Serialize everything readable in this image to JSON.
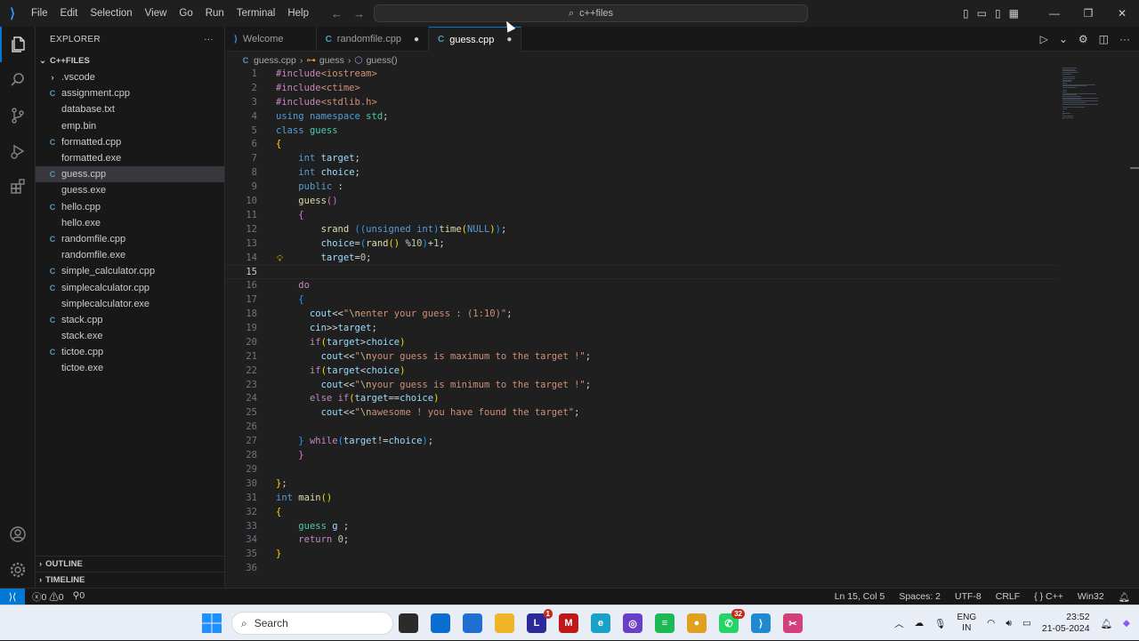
{
  "menu": [
    "File",
    "Edit",
    "Selection",
    "View",
    "Go",
    "Run",
    "Terminal",
    "Help"
  ],
  "search": {
    "text": "c++files"
  },
  "sidebar": {
    "title": "EXPLORER",
    "folder": "C++FILES",
    "files": [
      {
        "name": ".vscode",
        "type": "folder"
      },
      {
        "name": "assignment.cpp",
        "type": "cpp"
      },
      {
        "name": "database.txt",
        "type": "txt"
      },
      {
        "name": "emp.bin",
        "type": "bin"
      },
      {
        "name": "formatted.cpp",
        "type": "cpp"
      },
      {
        "name": "formatted.exe",
        "type": "exe"
      },
      {
        "name": "guess.cpp",
        "type": "cpp",
        "selected": true
      },
      {
        "name": "guess.exe",
        "type": "exe"
      },
      {
        "name": "hello.cpp",
        "type": "cpp"
      },
      {
        "name": "hello.exe",
        "type": "exe"
      },
      {
        "name": "randomfile.cpp",
        "type": "cpp"
      },
      {
        "name": "randomfile.exe",
        "type": "exe"
      },
      {
        "name": "simple_calculator.cpp",
        "type": "cpp"
      },
      {
        "name": "simplecalculator.cpp",
        "type": "cpp"
      },
      {
        "name": "simplecalculator.exe",
        "type": "exe"
      },
      {
        "name": "stack.cpp",
        "type": "cpp"
      },
      {
        "name": "stack.exe",
        "type": "exe"
      },
      {
        "name": "tictoe.cpp",
        "type": "cpp"
      },
      {
        "name": "tictoe.exe",
        "type": "exe"
      }
    ],
    "outline": "OUTLINE",
    "timeline": "TIMELINE"
  },
  "tabs": [
    {
      "label": "Welcome",
      "icon": "vscode-icon"
    },
    {
      "label": "randomfile.cpp",
      "icon": "cpp-icon",
      "modified": true
    },
    {
      "label": "guess.cpp",
      "icon": "cpp-icon",
      "modified": true,
      "active": true
    }
  ],
  "breadcrumb": [
    "guess.cpp",
    "guess",
    "guess()"
  ],
  "code": [
    [
      [
        "pp",
        "#include"
      ],
      [
        "str",
        "<iostream>"
      ]
    ],
    [
      [
        "pp",
        "#include"
      ],
      [
        "str",
        "<ctime>"
      ]
    ],
    [
      [
        "pp",
        "#include"
      ],
      [
        "str",
        "<stdlib.h>"
      ]
    ],
    [
      [
        "kw",
        "using"
      ],
      [
        "txt",
        " "
      ],
      [
        "kw",
        "namespace"
      ],
      [
        "txt",
        " "
      ],
      [
        "ty",
        "std"
      ],
      [
        "txt",
        ";"
      ]
    ],
    [
      [
        "kw",
        "class"
      ],
      [
        "txt",
        " "
      ],
      [
        "ty",
        "guess"
      ]
    ],
    [
      [
        "br1",
        "{"
      ]
    ],
    [
      [
        "txt",
        "    "
      ],
      [
        "kw",
        "int"
      ],
      [
        "txt",
        " "
      ],
      [
        "var",
        "target"
      ],
      [
        "txt",
        ";"
      ]
    ],
    [
      [
        "txt",
        "    "
      ],
      [
        "kw",
        "int"
      ],
      [
        "txt",
        " "
      ],
      [
        "var",
        "choice"
      ],
      [
        "txt",
        ";"
      ]
    ],
    [
      [
        "txt",
        "    "
      ],
      [
        "kw",
        "public"
      ],
      [
        "txt",
        " :"
      ]
    ],
    [
      [
        "txt",
        "    "
      ],
      [
        "fn",
        "guess"
      ],
      [
        "br2",
        "()"
      ]
    ],
    [
      [
        "txt",
        "    "
      ],
      [
        "br2",
        "{"
      ]
    ],
    [
      [
        "txt",
        "        "
      ],
      [
        "fn",
        "srand"
      ],
      [
        "txt",
        " "
      ],
      [
        "br3",
        "(("
      ],
      [
        "kw",
        "unsigned"
      ],
      [
        "txt",
        " "
      ],
      [
        "kw",
        "int"
      ],
      [
        "br3",
        ")"
      ],
      [
        "fn",
        "time"
      ],
      [
        "br1",
        "("
      ],
      [
        "kw",
        "NULL"
      ],
      [
        "br1",
        ")"
      ],
      [
        "br3",
        ")"
      ],
      [
        "txt",
        ";"
      ]
    ],
    [
      [
        "txt",
        "        "
      ],
      [
        "var",
        "choice"
      ],
      [
        "txt",
        "="
      ],
      [
        "br3",
        "("
      ],
      [
        "fn",
        "rand"
      ],
      [
        "br1",
        "()"
      ],
      [
        "txt",
        " %"
      ],
      [
        "num",
        "10"
      ],
      [
        "br3",
        ")"
      ],
      [
        "txt",
        "+"
      ],
      [
        "num",
        "1"
      ],
      [
        "txt",
        ";"
      ]
    ],
    [
      [
        "txt",
        "        "
      ],
      [
        "var",
        "target"
      ],
      [
        "txt",
        "="
      ],
      [
        "num",
        "0"
      ],
      [
        "txt",
        ";"
      ]
    ],
    [],
    [
      [
        "txt",
        "    "
      ],
      [
        "pp",
        "do"
      ]
    ],
    [
      [
        "txt",
        "    "
      ],
      [
        "br3",
        "{"
      ]
    ],
    [
      [
        "txt",
        "      "
      ],
      [
        "var",
        "cout"
      ],
      [
        "txt",
        "<<"
      ],
      [
        "str",
        "\""
      ],
      [
        "esc",
        "\\n"
      ],
      [
        "str",
        "enter your guess : (1:10)\""
      ],
      [
        "txt",
        ";"
      ]
    ],
    [
      [
        "txt",
        "      "
      ],
      [
        "var",
        "cin"
      ],
      [
        "txt",
        ">>"
      ],
      [
        "var",
        "target"
      ],
      [
        "txt",
        ";"
      ]
    ],
    [
      [
        "txt",
        "      "
      ],
      [
        "pp",
        "if"
      ],
      [
        "br1",
        "("
      ],
      [
        "var",
        "target"
      ],
      [
        "txt",
        ">"
      ],
      [
        "var",
        "choice"
      ],
      [
        "br1",
        ")"
      ]
    ],
    [
      [
        "txt",
        "        "
      ],
      [
        "var",
        "cout"
      ],
      [
        "txt",
        "<<"
      ],
      [
        "str",
        "\""
      ],
      [
        "esc",
        "\\n"
      ],
      [
        "str",
        "your guess is maximum to the target !\""
      ],
      [
        "txt",
        ";"
      ]
    ],
    [
      [
        "txt",
        "      "
      ],
      [
        "pp",
        "if"
      ],
      [
        "br1",
        "("
      ],
      [
        "var",
        "target"
      ],
      [
        "txt",
        "<"
      ],
      [
        "var",
        "choice"
      ],
      [
        "br1",
        ")"
      ]
    ],
    [
      [
        "txt",
        "        "
      ],
      [
        "var",
        "cout"
      ],
      [
        "txt",
        "<<"
      ],
      [
        "str",
        "\""
      ],
      [
        "esc",
        "\\n"
      ],
      [
        "str",
        "your guess is minimum to the target !\""
      ],
      [
        "txt",
        ";"
      ]
    ],
    [
      [
        "txt",
        "      "
      ],
      [
        "pp",
        "else"
      ],
      [
        "txt",
        " "
      ],
      [
        "pp",
        "if"
      ],
      [
        "br1",
        "("
      ],
      [
        "var",
        "target"
      ],
      [
        "txt",
        "=="
      ],
      [
        "var",
        "choice"
      ],
      [
        "br1",
        ")"
      ]
    ],
    [
      [
        "txt",
        "        "
      ],
      [
        "var",
        "cout"
      ],
      [
        "txt",
        "<<"
      ],
      [
        "str",
        "\""
      ],
      [
        "esc",
        "\\n"
      ],
      [
        "str",
        "awesome ! you have found the target\""
      ],
      [
        "txt",
        ";"
      ]
    ],
    [],
    [
      [
        "txt",
        "    "
      ],
      [
        "br3",
        "}"
      ],
      [
        "txt",
        " "
      ],
      [
        "pp",
        "while"
      ],
      [
        "br3",
        "("
      ],
      [
        "var",
        "target"
      ],
      [
        "txt",
        "!="
      ],
      [
        "var",
        "choice"
      ],
      [
        "br3",
        ")"
      ],
      [
        "txt",
        ";"
      ]
    ],
    [
      [
        "txt",
        "    "
      ],
      [
        "br2",
        "}"
      ]
    ],
    [],
    [
      [
        "br1",
        "}"
      ],
      [
        "txt",
        ";"
      ]
    ],
    [
      [
        "kw",
        "int"
      ],
      [
        "txt",
        " "
      ],
      [
        "fn",
        "main"
      ],
      [
        "br1",
        "()"
      ]
    ],
    [
      [
        "br1",
        "{"
      ]
    ],
    [
      [
        "txt",
        "    "
      ],
      [
        "ty",
        "guess"
      ],
      [
        "txt",
        " "
      ],
      [
        "var",
        "g"
      ],
      [
        "txt",
        " ;"
      ]
    ],
    [
      [
        "txt",
        "    "
      ],
      [
        "pp",
        "return"
      ],
      [
        "txt",
        " "
      ],
      [
        "num",
        "0"
      ],
      [
        "txt",
        ";"
      ]
    ],
    [
      [
        "br1",
        "}"
      ]
    ],
    []
  ],
  "current_line": 15,
  "status": {
    "errors": "0",
    "warnings": "0",
    "ports": "0",
    "position": "Ln 15, Col 5",
    "spaces": "Spaces: 2",
    "encoding": "UTF-8",
    "eol": "CRLF",
    "language": "{ } C++",
    "platform": "Win32"
  },
  "taskbar": {
    "search_placeholder": "Search",
    "apps": [
      {
        "name": "file-explorer-dark",
        "color": "#2b2b2b",
        "glyph": ""
      },
      {
        "name": "azure-app",
        "color": "#0a6ed1",
        "glyph": ""
      },
      {
        "name": "store",
        "color": "#1f6fd1",
        "glyph": ""
      },
      {
        "name": "folder",
        "color": "#f0b429",
        "glyph": ""
      },
      {
        "name": "linkedin-app",
        "color": "#2a2a9a",
        "glyph": "L",
        "badge": "1"
      },
      {
        "name": "mcafee",
        "color": "#c01818",
        "glyph": "M"
      },
      {
        "name": "edge",
        "color": "#1aa0c9",
        "glyph": "e"
      },
      {
        "name": "media-app",
        "color": "#6a3fc7",
        "glyph": "◎"
      },
      {
        "name": "spotify",
        "color": "#1db954",
        "glyph": "≡"
      },
      {
        "name": "chrome",
        "color": "#e0a020",
        "glyph": "●"
      },
      {
        "name": "whatsapp",
        "color": "#25d366",
        "glyph": "✆",
        "badge": "32"
      },
      {
        "name": "vscode",
        "color": "#1f8ad2",
        "glyph": "⟩"
      },
      {
        "name": "snipping-tool",
        "color": "#d23f7a",
        "glyph": "✂"
      }
    ],
    "lang_top": "ENG",
    "lang_bottom": "IN",
    "time": "23:52",
    "date": "21-05-2024"
  },
  "colors": {
    "accent": "#0078d4",
    "bg": "#1f1f1f",
    "sidebar": "#181818"
  }
}
